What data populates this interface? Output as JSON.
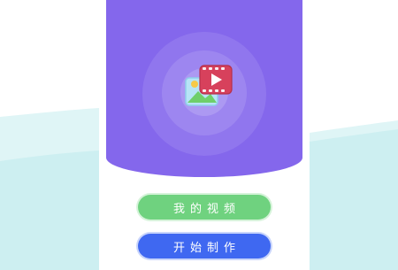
{
  "colors": {
    "hero_purple": "#8467ec",
    "video_button_green": "#6fd27f",
    "create_button_blue": "#3f68f1",
    "background_teal": "#cfeff2"
  },
  "icons": {
    "app_icon": "photo-video-icon"
  },
  "buttons": {
    "my_videos": "我的视频",
    "start_create": "开始制作"
  }
}
